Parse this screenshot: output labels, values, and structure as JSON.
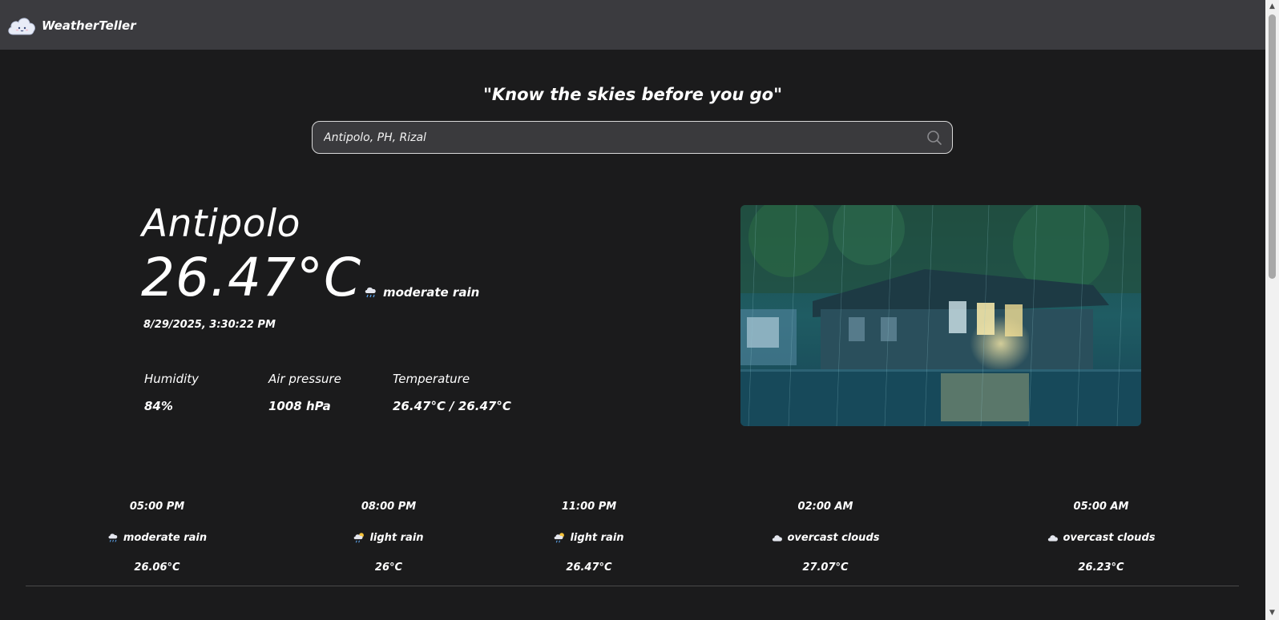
{
  "app": {
    "name": "WeatherTeller",
    "logo_icon": "cloud-face-icon"
  },
  "tagline": "\"Know the skies before you go\"",
  "search": {
    "value": "Antipolo, PH, Rizal",
    "icon": "search-icon"
  },
  "current": {
    "city": "Antipolo",
    "temperature": "26.47°C",
    "condition": "moderate rain",
    "condition_icon": "rain-cloud-icon",
    "datetime": "8/29/2025, 3:30:22 PM",
    "stats": [
      {
        "label": "Humidity",
        "value": "84%"
      },
      {
        "label": "Air pressure",
        "value": "1008 hPa"
      },
      {
        "label": "Temperature",
        "value": "26.47°C / 26.47°C"
      }
    ]
  },
  "forecast": [
    {
      "time": "05:00 PM",
      "condition": "moderate rain",
      "icon": "rain-cloud-icon",
      "temp": "26.06°C"
    },
    {
      "time": "08:00 PM",
      "condition": "light rain",
      "icon": "sun-rain-icon",
      "temp": "26°C"
    },
    {
      "time": "11:00 PM",
      "condition": "light rain",
      "icon": "sun-rain-icon",
      "temp": "26.47°C"
    },
    {
      "time": "02:00 AM",
      "condition": "overcast clouds",
      "icon": "cloud-icon",
      "temp": "27.07°C"
    },
    {
      "time": "05:00 AM",
      "condition": "overcast clouds",
      "icon": "cloud-icon",
      "temp": "26.23°C"
    }
  ],
  "colors": {
    "topbar": "#3b3b3f",
    "background": "#1b1b1c",
    "search_bg": "#3a3a3d",
    "text": "#ffffff"
  }
}
